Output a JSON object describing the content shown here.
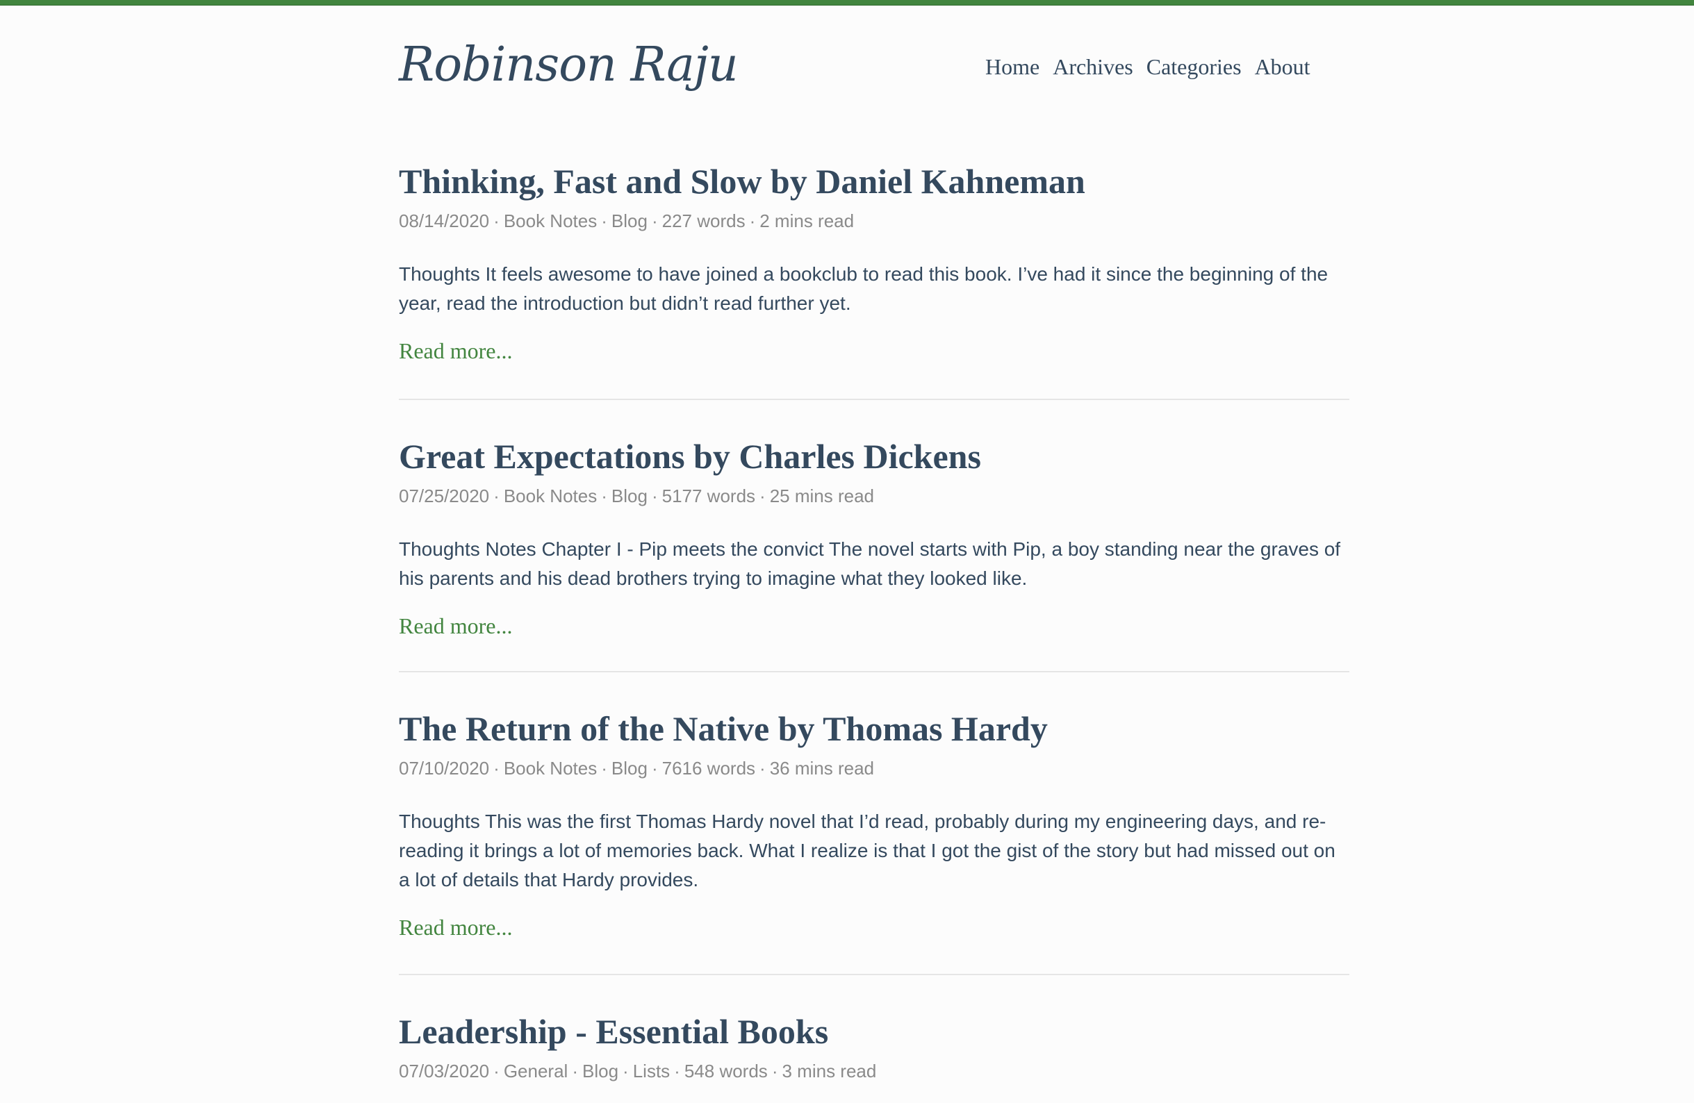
{
  "site": {
    "title": "Robinson Raju",
    "accent_color": "#42853f",
    "text_color": "#34495e"
  },
  "nav": {
    "items": [
      {
        "label": "Home"
      },
      {
        "label": "Archives"
      },
      {
        "label": "Categories"
      },
      {
        "label": "About"
      }
    ]
  },
  "posts": [
    {
      "title": "Thinking, Fast and Slow by Daniel Kahneman",
      "date": "08/14/2020",
      "categories": [
        "Book Notes",
        "Blog"
      ],
      "words": "227 words",
      "read_time": "2 mins read",
      "summary": "Thoughts It feels awesome to have joined a bookclub to read this book. I’ve had it since the beginning of the year, read the introduction but didn’t read further yet.",
      "read_more": "Read more..."
    },
    {
      "title": "Great Expectations by Charles Dickens",
      "date": "07/25/2020",
      "categories": [
        "Book Notes",
        "Blog"
      ],
      "words": "5177 words",
      "read_time": "25 mins read",
      "summary": "Thoughts Notes Chapter I - Pip meets the convict The novel starts with Pip, a boy standing near the graves of his parents and his dead brothers trying to imagine what they looked like.",
      "read_more": "Read more..."
    },
    {
      "title": "The Return of the Native by Thomas Hardy",
      "date": "07/10/2020",
      "categories": [
        "Book Notes",
        "Blog"
      ],
      "words": "7616 words",
      "read_time": "36 mins read",
      "summary": "Thoughts This was the first Thomas Hardy novel that I’d read, probably during my engineering days, and re-reading it brings a lot of memories back. What I realize is that I got the gist of the story but had missed out on a lot of details that Hardy provides.",
      "read_more": "Read more..."
    },
    {
      "title": "Leadership - Essential Books",
      "date": "07/03/2020",
      "categories": [
        "General",
        "Blog",
        "Lists"
      ],
      "words": "548 words",
      "read_time": "3 mins read",
      "summary": "",
      "read_more": ""
    }
  ]
}
